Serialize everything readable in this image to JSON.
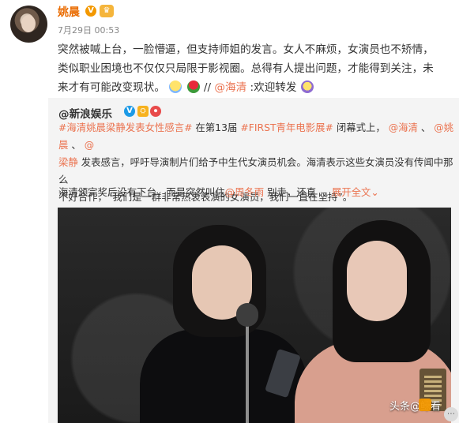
{
  "post": {
    "author": "姚晨",
    "verified_badge": "V",
    "crown_badge": "♛",
    "timestamp": "7月29日 00:53",
    "content_lines": [
      "突然被喊上台，一脸懵逼，但支持师姐的发言。女人不麻烦，女演员也不矫情，",
      "类似职业困境也不仅仅只局限于影视圈。总得有人提出问题，才能得到关注，未",
      "来才有可能改变现状。"
    ],
    "content_tail": {
      "prefix": "//",
      "mention": "@海清",
      "suffix": ":欢迎转发"
    }
  },
  "repost": {
    "author": "@新浪娱乐",
    "badge_v": "V",
    "badge_2": "⛭",
    "badge_3": "⏺",
    "text": {
      "line1_parts": [
        {
          "type": "mention",
          "text": "#海清姚晨梁静发表女性感言#"
        },
        {
          "type": "text",
          "text": " 在第13届"
        },
        {
          "type": "mention",
          "text": "#FIRST青年电影展#"
        },
        {
          "type": "text",
          "text": " 闭幕式上，"
        },
        {
          "type": "mention",
          "text": "@海清"
        },
        {
          "type": "text",
          "text": " 、"
        },
        {
          "type": "mention",
          "text": "@姚晨"
        },
        {
          "type": "text",
          "text": " 、"
        },
        {
          "type": "mention",
          "text": "@"
        }
      ],
      "line2_parts": [
        {
          "type": "mention",
          "text": "梁静"
        },
        {
          "type": "text",
          "text": " 发表感言，呼吁导演制片们给予中生代女演员机会。海清表示这些女演员没有传闻中那么"
        }
      ],
      "line3": "不好合作，“我们是一群非常热衷表演的女演员，我们一直在坚持”。"
    },
    "line4": {
      "text": "海清颁完奖后没有下台，而是突然叫住",
      "mention": "@周冬雨",
      "after": " 别走，还直 ...",
      "more": "展开全文",
      "more_chevron": "⌄"
    },
    "video": {
      "watermark": "头条@鲸看"
    }
  }
}
